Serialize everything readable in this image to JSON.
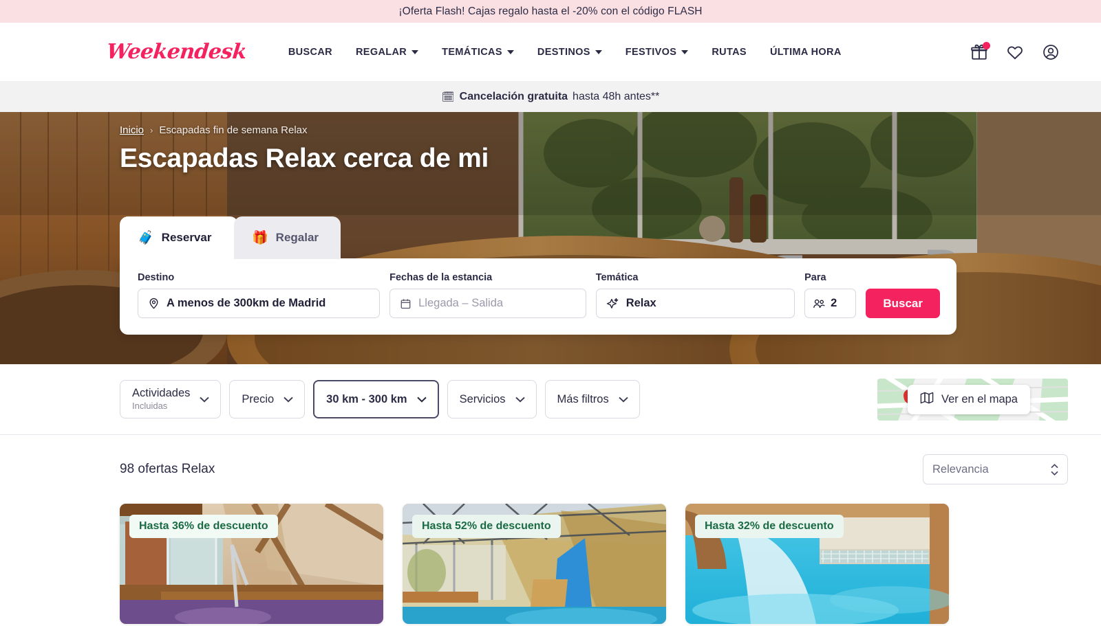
{
  "flash_banner": {
    "text": "¡Oferta Flash! Cajas regalo hasta el -20% con el código FLASH",
    "bg_color": "#fbe0e3"
  },
  "header": {
    "logo": "Weekendesk",
    "logo_color": "#f4225f",
    "nav": [
      {
        "label": "BUSCAR",
        "has_caret": false
      },
      {
        "label": "REGALAR",
        "has_caret": true
      },
      {
        "label": "TEMÁTICAS",
        "has_caret": true
      },
      {
        "label": "DESTINOS",
        "has_caret": true
      },
      {
        "label": "FESTIVOS",
        "has_caret": true
      },
      {
        "label": "RUTAS",
        "has_caret": false
      },
      {
        "label": "ÚLTIMA HORA",
        "has_caret": false
      }
    ],
    "icons": [
      {
        "name": "gift-icon",
        "badge": true
      },
      {
        "name": "heart-icon",
        "badge": false
      },
      {
        "name": "account-icon",
        "badge": false
      }
    ]
  },
  "cancellation_strip": {
    "emoji": "🗓",
    "bold_text": "Cancelación gratuita",
    "rest_text": "hasta 48h antes**"
  },
  "hero": {
    "breadcrumb": {
      "home": "Inicio",
      "separator": "›",
      "current": "Escapadas fin de semana Relax"
    },
    "title": "Escapadas Relax cerca de mi"
  },
  "search_widget": {
    "tabs": [
      {
        "label": "Reservar",
        "emoji": "🧳",
        "active": true
      },
      {
        "label": "Regalar",
        "emoji": "🎁",
        "active": false
      }
    ],
    "fields": {
      "destino": {
        "label": "Destino",
        "value": "A menos de 300km de Madrid",
        "icon": "location-pin-icon"
      },
      "fechas": {
        "label": "Fechas de la estancia",
        "placeholder": "Llegada – Salida",
        "icon": "calendar-icon"
      },
      "tematica": {
        "label": "Temática",
        "value": "Relax",
        "icon": "sparkle-icon"
      },
      "para": {
        "label": "Para",
        "value": "2",
        "icon": "guests-icon"
      }
    },
    "submit_label": "Buscar",
    "submit_color": "#f4225f"
  },
  "filter_bar": {
    "chips": [
      {
        "title": "Actividades",
        "sub": "Incluidas",
        "active": false
      },
      {
        "title": "Precio",
        "sub": "",
        "active": false
      },
      {
        "title": "30 km - 300 km",
        "sub": "",
        "active": true
      },
      {
        "title": "Servicios",
        "sub": "",
        "active": false
      },
      {
        "title": "Más filtros",
        "sub": "",
        "active": false
      }
    ],
    "map_button_label": "Ver en el mapa"
  },
  "results": {
    "count_text": "98 ofertas Relax",
    "sort_value": "Relevancia",
    "cards": [
      {
        "discount": "Hasta 36% de descuento"
      },
      {
        "discount": "Hasta 52% de descuento"
      },
      {
        "discount": "Hasta 32% de descuento"
      }
    ]
  }
}
